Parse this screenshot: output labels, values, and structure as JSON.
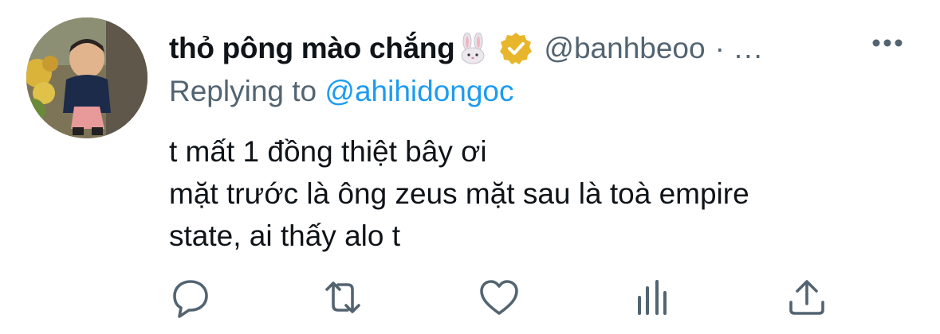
{
  "tweet": {
    "display_name": "thỏ pông mào chắng",
    "name_emoji": "rabbit-face",
    "verified_badge": "gold-verified-icon",
    "handle": "@banhbeoo",
    "separator": "·",
    "time": "...",
    "replying_prefix": "Replying to ",
    "replying_to": "@ahihidongoc",
    "body_lines": [
      "t mất 1 đồng thiệt bây ơi",
      "mặt trước là ông zeus mặt sau là toà empire",
      "state, ai thấy alo t"
    ]
  },
  "actions": {
    "reply_icon": "reply-icon",
    "retweet_icon": "retweet-icon",
    "like_icon": "heart-icon",
    "analytics_icon": "analytics-icon",
    "share_icon": "share-icon",
    "more_icon": "more-icon"
  },
  "colors": {
    "text": "#0f1419",
    "secondary": "#536471",
    "link": "#1d9bf0",
    "verified_gold": "#e8b62c"
  }
}
